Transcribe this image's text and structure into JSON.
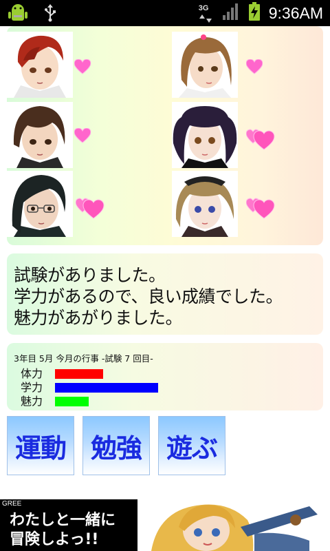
{
  "status_bar": {
    "time": "9:36AM",
    "network": "3G",
    "icons": [
      "android-notification-icon",
      "usb-icon",
      "3g-data-icon",
      "signal-icon",
      "battery-charging-icon"
    ]
  },
  "characters": [
    {
      "id": "red-hair-boy",
      "hearts": 1
    },
    {
      "id": "brown-hair-girl",
      "hearts": 1
    },
    {
      "id": "dark-brown-boy",
      "hearts": 1
    },
    {
      "id": "purple-twintail-girl",
      "hearts": 2
    },
    {
      "id": "glasses-boy",
      "hearts": 2
    },
    {
      "id": "blonde-gothic-girl",
      "hearts": 2
    }
  ],
  "message": {
    "line1": "試験がありました。",
    "line2": "学力があるので、良い成績でした。",
    "line3": "魅力があがりました。"
  },
  "status": {
    "header": "3年目 5月 今月の行事 -試験 7 回目-",
    "stats": [
      {
        "label": "体力",
        "level": 0.38,
        "color": "#ff0000"
      },
      {
        "label": "学力",
        "level": 0.82,
        "color": "#0000ff"
      },
      {
        "label": "魅力",
        "level": 0.27,
        "color": "#00ff00"
      }
    ]
  },
  "actions": {
    "exercise": "運動",
    "study": "勉強",
    "play": "遊ぶ"
  },
  "ad": {
    "brand": "GREE",
    "line1": "わたしと一緒に",
    "line2": "冒険しよっ!!"
  }
}
